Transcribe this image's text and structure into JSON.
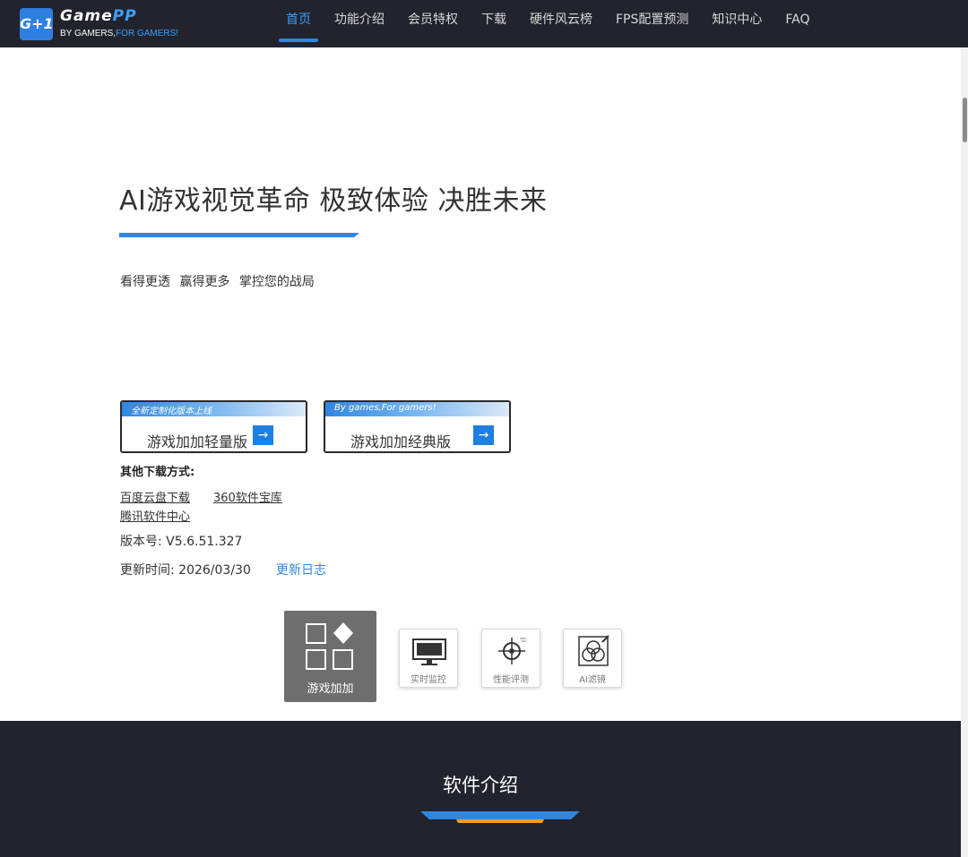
{
  "header": {
    "logo_badge": "G+1",
    "logo_name_main": "Game",
    "logo_name_accent": "PP",
    "slogan_main": "BY GAMERS,",
    "slogan_accent": "FOR GAMERS!",
    "nav": [
      "首页",
      "功能介绍",
      "会员特权",
      "下载",
      "硬件风云榜",
      "FPS配置预测",
      "知识中心",
      "FAQ"
    ],
    "active_nav": "首页"
  },
  "hero": {
    "title": "AI游戏视觉革命 极致体验 决胜未来",
    "subtitle": "看得更透 赢得更多 掌控您的战局"
  },
  "downloads": {
    "lite": {
      "ribbon": "全新定制化版本上线",
      "label": "游戏加加轻量版",
      "arrow": "→"
    },
    "classic": {
      "ribbon": "By games,For gamers!",
      "label": "游戏加加经典版",
      "arrow": "→"
    },
    "other_title": "其他下载方式:",
    "links": [
      "百度云盘下载",
      "360软件宝库",
      "腾讯软件中心"
    ],
    "version": "版本号: V5.6.51.327",
    "update_time": "更新时间: 2026/03/30",
    "changelog": "更新日志"
  },
  "features": [
    {
      "label": "游戏加加",
      "icon": "grid-diamond-icon"
    },
    {
      "label": "实时监控",
      "icon": "monitor-icon"
    },
    {
      "label": "性能评测",
      "icon": "crosshair-icon"
    },
    {
      "label": "AI滤镜",
      "icon": "filter-icon"
    }
  ],
  "intro": {
    "title": "软件介绍"
  },
  "colors": {
    "header_bg": "#22232d",
    "accent": "#2f86e0",
    "gold": "#f0a020"
  }
}
